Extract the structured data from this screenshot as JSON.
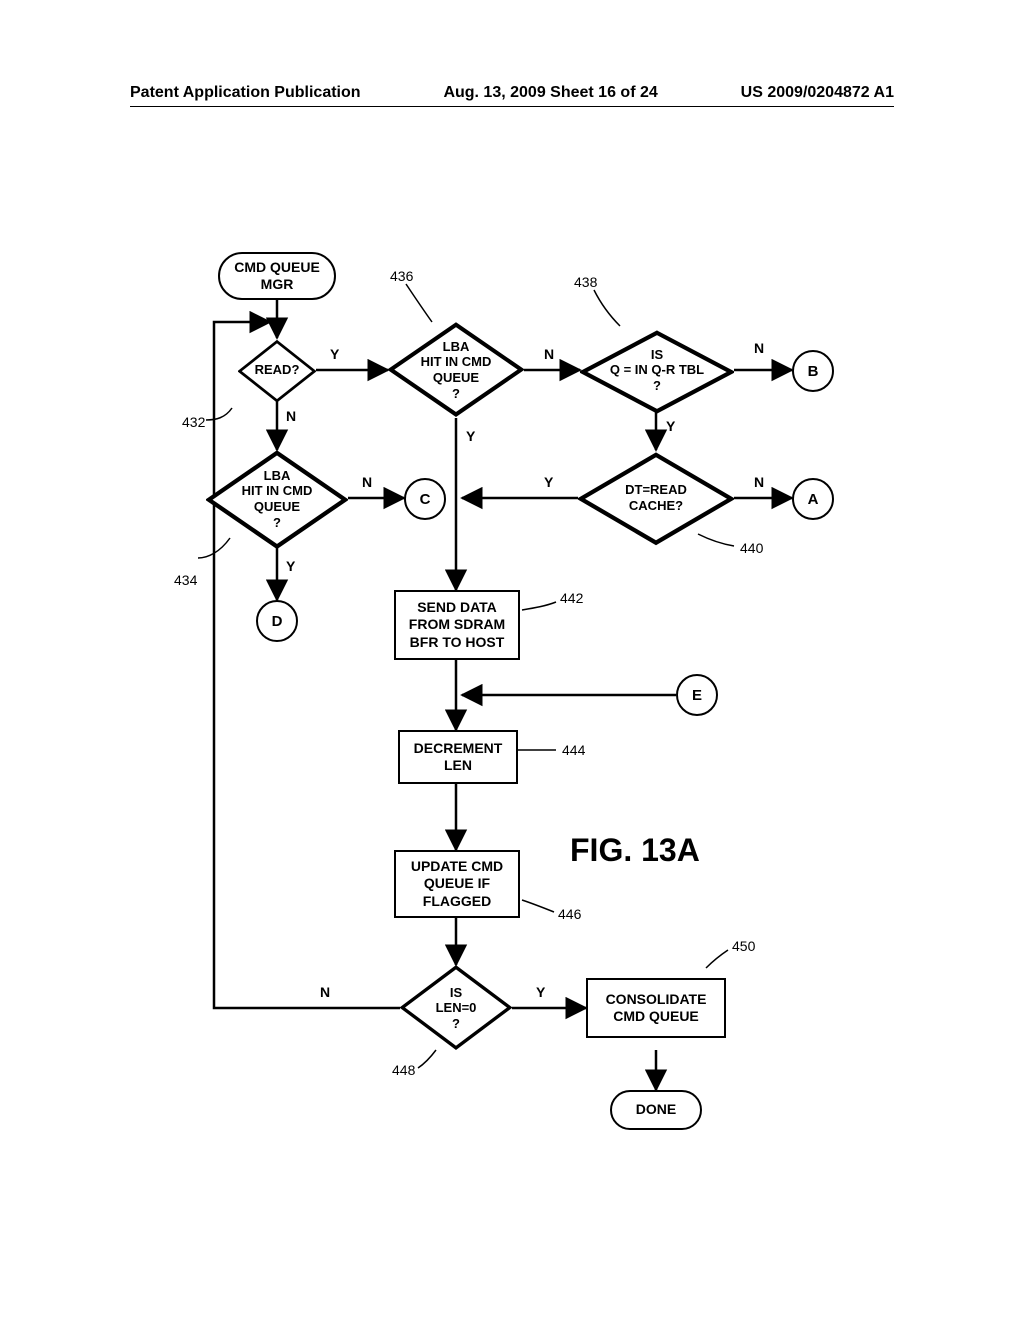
{
  "header": {
    "left": "Patent Application Publication",
    "center": "Aug. 13, 2009   Sheet 16 of 24",
    "right": "US 2009/0204872 A1"
  },
  "fig_title": "FIG. 13A",
  "nodes": {
    "start": "CMD QUEUE\nMGR",
    "read": "READ?",
    "hit434": "LBA\nHIT IN CMD\nQUEUE\n?",
    "hit436": "LBA\nHIT IN CMD\nQUEUE\n?",
    "qrtbl": "IS\nQ = IN Q-R TBL\n?",
    "readcache": "DT=READ\nCACHE?",
    "senddata": "SEND DATA\nFROM SDRAM\nBFR TO HOST",
    "declen": "DECREMENT\nLEN",
    "update": "UPDATE CMD\nQUEUE IF\nFLAGGED",
    "len0": "IS\nLEN=0\n?",
    "consolidate": "CONSOLIDATE\nCMD QUEUE",
    "done": "DONE"
  },
  "connectors": {
    "A": "A",
    "B": "B",
    "C": "C",
    "D": "D",
    "E": "E"
  },
  "labels": {
    "Y": "Y",
    "N": "N"
  },
  "refs": {
    "r432": "432",
    "r434": "434",
    "r436": "436",
    "r438": "438",
    "r440": "440",
    "r442": "442",
    "r444": "444",
    "r446": "446",
    "r448": "448",
    "r450": "450"
  },
  "chart_data": {
    "type": "flowchart",
    "title": "FIG. 13A",
    "nodes": [
      {
        "id": "start",
        "type": "terminator",
        "label": "CMD QUEUE MGR"
      },
      {
        "id": "432",
        "type": "decision",
        "label": "READ?"
      },
      {
        "id": "434",
        "type": "decision",
        "label": "LBA HIT IN CMD QUEUE ?"
      },
      {
        "id": "436",
        "type": "decision",
        "label": "LBA HIT IN CMD QUEUE ?"
      },
      {
        "id": "438",
        "type": "decision",
        "label": "IS Q = IN Q-R TBL ?"
      },
      {
        "id": "440",
        "type": "decision",
        "label": "DT=READ CACHE?"
      },
      {
        "id": "442",
        "type": "process",
        "label": "SEND DATA FROM SDRAM BFR TO HOST"
      },
      {
        "id": "444",
        "type": "process",
        "label": "DECREMENT LEN"
      },
      {
        "id": "446",
        "type": "process",
        "label": "UPDATE CMD QUEUE IF FLAGGED"
      },
      {
        "id": "448",
        "type": "decision",
        "label": "IS LEN=0 ?"
      },
      {
        "id": "450",
        "type": "process",
        "label": "CONSOLIDATE CMD QUEUE"
      },
      {
        "id": "done",
        "type": "terminator",
        "label": "DONE"
      },
      {
        "id": "A",
        "type": "connector",
        "label": "A"
      },
      {
        "id": "B",
        "type": "connector",
        "label": "B"
      },
      {
        "id": "C",
        "type": "connector",
        "label": "C"
      },
      {
        "id": "D",
        "type": "connector",
        "label": "D"
      },
      {
        "id": "E",
        "type": "connector",
        "label": "E"
      }
    ],
    "edges": [
      {
        "from": "start",
        "to": "432"
      },
      {
        "from": "432",
        "to": "436",
        "label": "Y"
      },
      {
        "from": "432",
        "to": "434",
        "label": "N"
      },
      {
        "from": "434",
        "to": "C",
        "label": "N"
      },
      {
        "from": "434",
        "to": "D",
        "label": "Y"
      },
      {
        "from": "436",
        "to": "438",
        "label": "N"
      },
      {
        "from": "436",
        "to": "442",
        "label": "Y"
      },
      {
        "from": "438",
        "to": "B",
        "label": "N"
      },
      {
        "from": "438",
        "to": "440",
        "label": "Y"
      },
      {
        "from": "440",
        "to": "A",
        "label": "N"
      },
      {
        "from": "440",
        "to": "442",
        "label": "Y",
        "note": "merges into 436-Y path"
      },
      {
        "from": "442",
        "to": "444"
      },
      {
        "from": "E",
        "to": "444",
        "note": "merges into path above 444"
      },
      {
        "from": "444",
        "to": "446"
      },
      {
        "from": "446",
        "to": "448"
      },
      {
        "from": "448",
        "to": "432",
        "label": "N",
        "note": "loop back"
      },
      {
        "from": "448",
        "to": "450",
        "label": "Y"
      },
      {
        "from": "450",
        "to": "done"
      }
    ]
  }
}
